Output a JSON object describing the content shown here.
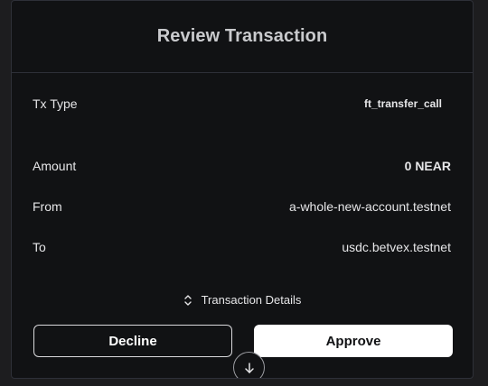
{
  "header": {
    "title": "Review Transaction"
  },
  "rows": {
    "tx_type": {
      "label": "Tx Type",
      "value": "ft_transfer_call"
    },
    "amount": {
      "label": "Amount",
      "value": "0 NEAR"
    },
    "from": {
      "label": "From",
      "value": "a-whole-new-account.testnet"
    },
    "to": {
      "label": "To",
      "value": "usdc.betvex.testnet"
    }
  },
  "details": {
    "label": "Transaction Details",
    "icon": "chevron-up-down-icon"
  },
  "actions": {
    "decline_label": "Decline",
    "approve_label": "Approve"
  },
  "scroll": {
    "icon": "arrow-down-icon"
  },
  "colors": {
    "background": "#111214",
    "border": "#2e3038",
    "approve_bg": "#ffffff"
  }
}
